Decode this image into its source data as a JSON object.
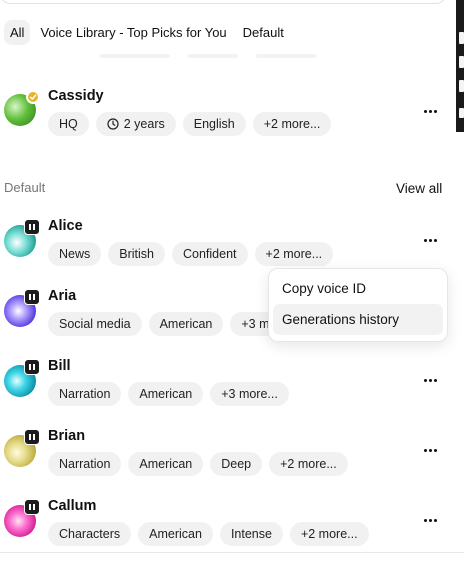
{
  "filters": [
    "All",
    "Voice Library - Top Picks for You",
    "Default"
  ],
  "featured": {
    "name": "Cassidy",
    "tags": [
      "HQ",
      "2 years",
      "English",
      "+2 more..."
    ]
  },
  "section": {
    "label": "Default",
    "view_all": "View all"
  },
  "voices": [
    {
      "name": "Alice",
      "tags": [
        "News",
        "British",
        "Confident",
        "+2 more..."
      ]
    },
    {
      "name": "Aria",
      "tags": [
        "Social media",
        "American",
        "+3 m"
      ]
    },
    {
      "name": "Bill",
      "tags": [
        "Narration",
        "American",
        "+3 more..."
      ]
    },
    {
      "name": "Brian",
      "tags": [
        "Narration",
        "American",
        "Deep",
        "+2 more..."
      ]
    },
    {
      "name": "Callum",
      "tags": [
        "Characters",
        "American",
        "Intense",
        "+2 more..."
      ]
    }
  ],
  "context_menu": [
    "Copy voice ID",
    "Generations history"
  ],
  "icons": {
    "verified": "check-badge-icon",
    "duration": "clock-icon",
    "play": "pause-icon",
    "more": "more-horizontal-icon"
  },
  "colors": {
    "tag_bg": "#f1f1f1",
    "badge_gold": "#e7b52b",
    "menu_hover": "#f2f2f2"
  }
}
